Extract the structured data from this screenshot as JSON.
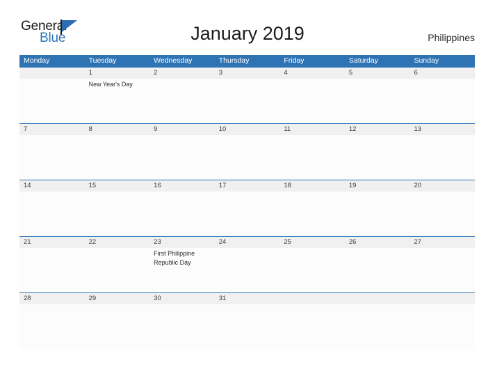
{
  "brand": {
    "name_part1": "General",
    "name_part2": "Blue",
    "flag_color": "#2b6cb3",
    "blue_color": "#2b74b8"
  },
  "header": {
    "title": "January 2019",
    "country": "Philippines"
  },
  "theme": {
    "header_band": "#2e74b5",
    "date_band": "#f0f0f0",
    "body_bg": "#fcfcfc",
    "row_divider": "#2e74b5",
    "date_text": "#3a3a3a",
    "event_text": "#2b2b2b"
  },
  "calendar": {
    "weekdays": [
      "Monday",
      "Tuesday",
      "Wednesday",
      "Thursday",
      "Friday",
      "Saturday",
      "Sunday"
    ],
    "weeks": [
      {
        "days": [
          {
            "date": "",
            "event": ""
          },
          {
            "date": "1",
            "event": "New Year's Day"
          },
          {
            "date": "2",
            "event": ""
          },
          {
            "date": "3",
            "event": ""
          },
          {
            "date": "4",
            "event": ""
          },
          {
            "date": "5",
            "event": ""
          },
          {
            "date": "6",
            "event": ""
          }
        ]
      },
      {
        "days": [
          {
            "date": "7",
            "event": ""
          },
          {
            "date": "8",
            "event": ""
          },
          {
            "date": "9",
            "event": ""
          },
          {
            "date": "10",
            "event": ""
          },
          {
            "date": "11",
            "event": ""
          },
          {
            "date": "12",
            "event": ""
          },
          {
            "date": "13",
            "event": ""
          }
        ]
      },
      {
        "days": [
          {
            "date": "14",
            "event": ""
          },
          {
            "date": "15",
            "event": ""
          },
          {
            "date": "16",
            "event": ""
          },
          {
            "date": "17",
            "event": ""
          },
          {
            "date": "18",
            "event": ""
          },
          {
            "date": "19",
            "event": ""
          },
          {
            "date": "20",
            "event": ""
          }
        ]
      },
      {
        "days": [
          {
            "date": "21",
            "event": ""
          },
          {
            "date": "22",
            "event": ""
          },
          {
            "date": "23",
            "event": "First Philippine Republic Day"
          },
          {
            "date": "24",
            "event": ""
          },
          {
            "date": "25",
            "event": ""
          },
          {
            "date": "26",
            "event": ""
          },
          {
            "date": "27",
            "event": ""
          }
        ]
      },
      {
        "days": [
          {
            "date": "28",
            "event": ""
          },
          {
            "date": "29",
            "event": ""
          },
          {
            "date": "30",
            "event": ""
          },
          {
            "date": "31",
            "event": ""
          },
          {
            "date": "",
            "event": ""
          },
          {
            "date": "",
            "event": ""
          },
          {
            "date": "",
            "event": ""
          }
        ]
      }
    ]
  }
}
